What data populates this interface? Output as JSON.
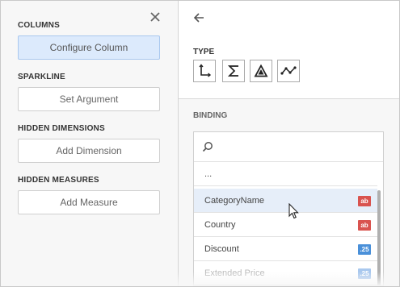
{
  "left": {
    "columns_title": "COLUMNS",
    "configure_label": "Configure Column",
    "sparkline_title": "SPARKLINE",
    "set_argument_label": "Set Argument",
    "hidden_dimensions_title": "HIDDEN DIMENSIONS",
    "add_dimension_label": "Add Dimension",
    "hidden_measures_title": "HIDDEN MEASURES",
    "add_measure_label": "Add Measure"
  },
  "right": {
    "type_title": "TYPE",
    "type_icons": [
      "dimension-icon",
      "measure-icon",
      "delta-icon",
      "sparkline-icon"
    ],
    "binding_title": "BINDING",
    "search_placeholder": "",
    "fields": [
      {
        "label": "...",
        "badge": ""
      },
      {
        "label": "CategoryName",
        "badge": "ab",
        "badge_color": "#d9534f",
        "highlighted": true
      },
      {
        "label": "Country",
        "badge": "ab",
        "badge_color": "#d9534f"
      },
      {
        "label": "Discount",
        "badge": ".25",
        "badge_color": "#4a90d9"
      },
      {
        "label": "Extended Price",
        "badge": ".25",
        "badge_color": "#4a90d9",
        "faded": true
      }
    ]
  },
  "colors": {
    "accent": "#dceafc",
    "highlight": "#e6eef9",
    "string_badge": "#d9534f",
    "number_badge": "#4a90d9"
  }
}
